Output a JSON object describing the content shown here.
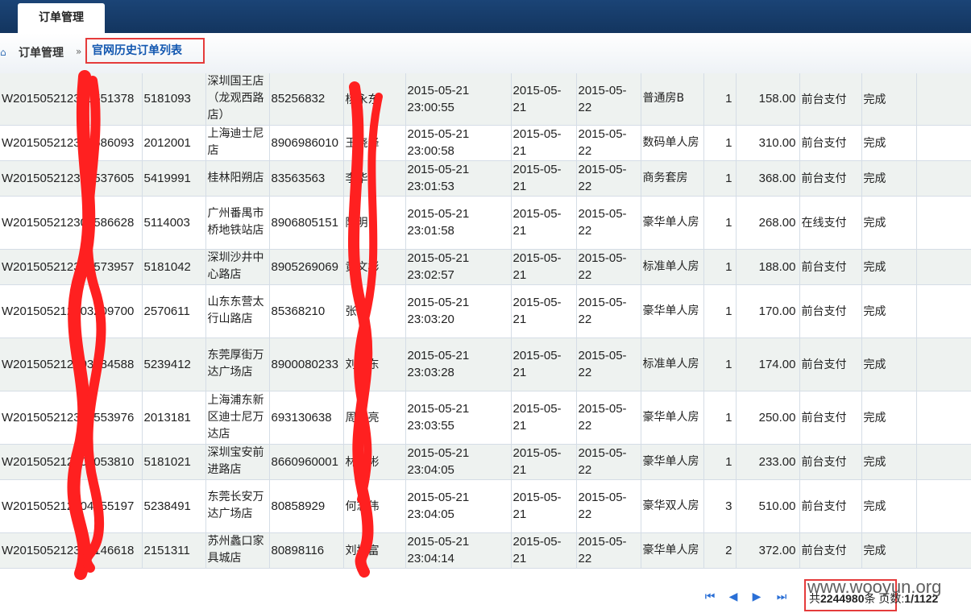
{
  "header": {
    "tab_label": "订单管理"
  },
  "breadcrumb": {
    "root": "订单管理",
    "separator": "»",
    "current": "官网历史订单列表"
  },
  "table": {
    "rows": [
      {
        "order": "W201505212300551378",
        "code": "5181093",
        "hotel": "深圳国王店（龙观西路店）",
        "phone": "85256832",
        "guest": "杨永东",
        "created": "2015-05-21 23:00:55",
        "checkin": "2015-05-21",
        "checkout": "2015-05-22",
        "room": "普通房B",
        "qty": "1",
        "amount": "158.00",
        "pay": "前台支付",
        "status": "完成"
      },
      {
        "order": "W201505212300586093",
        "code": "2012001",
        "hotel": "上海迪士尼店",
        "phone": "8906986010",
        "guest": "王晓峰",
        "created": "2015-05-21 23:00:58",
        "checkin": "2015-05-21",
        "checkout": "2015-05-22",
        "room": "数码单人房",
        "qty": "1",
        "amount": "310.00",
        "pay": "前台支付",
        "status": "完成"
      },
      {
        "order": "W201505212301537605",
        "code": "5419991",
        "hotel": "桂林阳朔店",
        "phone": "83563563",
        "guest": "李华",
        "created": "2015-05-21 23:01:53",
        "checkin": "2015-05-21",
        "checkout": "2015-05-22",
        "room": "商务套房",
        "qty": "1",
        "amount": "368.00",
        "pay": "前台支付",
        "status": "完成"
      },
      {
        "order": "W201505212301586628",
        "code": "5114003",
        "hotel": "广州番禺市桥地铁站店",
        "phone": "8906805151",
        "guest": "陈明",
        "created": "2015-05-21 23:01:58",
        "checkin": "2015-05-21",
        "checkout": "2015-05-22",
        "room": "豪华单人房",
        "qty": "1",
        "amount": "268.00",
        "pay": "在线支付",
        "status": "完成"
      },
      {
        "order": "W201505212302573957",
        "code": "5181042",
        "hotel": "深圳沙井中心路店",
        "phone": "8905269069",
        "guest": "黄文彬",
        "created": "2015-05-21 23:02:57",
        "checkin": "2015-05-21",
        "checkout": "2015-05-22",
        "room": "标准单人房",
        "qty": "1",
        "amount": "188.00",
        "pay": "前台支付",
        "status": "完成"
      },
      {
        "order": "W201505212303209700",
        "code": "2570611",
        "hotel": "山东东营太行山路店",
        "phone": "85368210",
        "guest": "张磊",
        "created": "2015-05-21 23:03:20",
        "checkin": "2015-05-21",
        "checkout": "2015-05-22",
        "room": "豪华单人房",
        "qty": "1",
        "amount": "170.00",
        "pay": "前台支付",
        "status": "完成"
      },
      {
        "order": "W201505212303284588",
        "code": "5239412",
        "hotel": "东莞厚街万达广场店",
        "phone": "8900080233",
        "guest": "刘小东",
        "created": "2015-05-21 23:03:28",
        "checkin": "2015-05-21",
        "checkout": "2015-05-22",
        "room": "标准单人房",
        "qty": "1",
        "amount": "174.00",
        "pay": "前台支付",
        "status": "完成"
      },
      {
        "order": "W201505212303553976",
        "code": "2013181",
        "hotel": "上海浦东新区迪士尼万达店",
        "phone": "693130638",
        "guest": "周文亮",
        "created": "2015-05-21 23:03:55",
        "checkin": "2015-05-21",
        "checkout": "2015-05-22",
        "room": "豪华单人房",
        "qty": "1",
        "amount": "250.00",
        "pay": "前台支付",
        "status": "完成"
      },
      {
        "order": "W201505212304053810",
        "code": "5181021",
        "hotel": "深圳宝安前进路店",
        "phone": "8660960001",
        "guest": "林家彬",
        "created": "2015-05-21 23:04:05",
        "checkin": "2015-05-21",
        "checkout": "2015-05-22",
        "room": "豪华单人房",
        "qty": "1",
        "amount": "233.00",
        "pay": "前台支付",
        "status": "完成"
      },
      {
        "order": "W201505212304055197",
        "code": "5238491",
        "hotel": "东莞长安万达广场店",
        "phone": "80858929",
        "guest": "何志伟",
        "created": "2015-05-21 23:04:05",
        "checkin": "2015-05-21",
        "checkout": "2015-05-22",
        "room": "豪华双人房",
        "qty": "3",
        "amount": "510.00",
        "pay": "前台支付",
        "status": "完成"
      },
      {
        "order": "W201505212304146618",
        "code": "2151311",
        "hotel": "苏州蠡口家具城店",
        "phone": "80898116",
        "guest": "刘振富",
        "created": "2015-05-21 23:04:14",
        "checkin": "2015-05-21",
        "checkout": "2015-05-22",
        "room": "豪华单人房",
        "qty": "2",
        "amount": "372.00",
        "pay": "前台支付",
        "status": "完成"
      }
    ]
  },
  "pager": {
    "total_prefix": "共",
    "total_count": "2244980",
    "total_suffix": "条",
    "pages_prefix": "页数:",
    "pages_value": "1/1122",
    "watermark": "www.wooyun.org"
  },
  "colors": {
    "topbar": "#1b4476",
    "highlight_border": "#e53b3b",
    "link": "#1257b0",
    "redaction": "#ff2020"
  },
  "icons": [
    "breadcrumb-home-icon",
    "first-page-icon",
    "prev-page-icon",
    "next-page-icon",
    "last-page-icon"
  ]
}
